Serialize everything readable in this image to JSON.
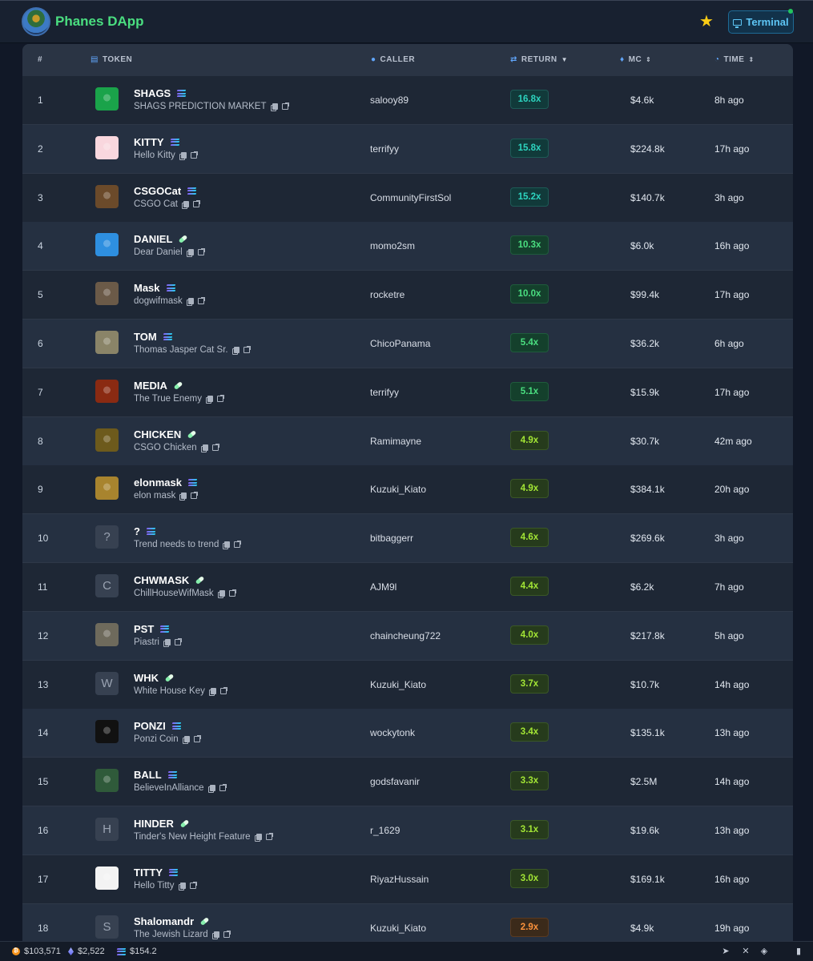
{
  "app": {
    "title": "Phanes DApp",
    "terminal_label": "Terminal"
  },
  "table": {
    "headers": {
      "rank": "#",
      "token": "TOKEN",
      "caller": "CALLER",
      "return": "RETURN",
      "mc": "MC",
      "time": "TIME"
    },
    "sort_column": "RETURN",
    "rows": [
      {
        "rank": "1",
        "symbol": "SHAGS",
        "name": "SHAGS PREDICTION MARKET",
        "chain": "solana",
        "caller": "salooy89",
        "return": "16.8x",
        "return_tier": "teal",
        "mc": "$4.6k",
        "time": "8h ago",
        "avatar": "image",
        "avatar_color": "#1aa34a"
      },
      {
        "rank": "2",
        "symbol": "KITTY",
        "name": "Hello Kitty",
        "chain": "solana",
        "caller": "terrifyy",
        "return": "15.8x",
        "return_tier": "teal",
        "mc": "$224.8k",
        "time": "17h ago",
        "avatar": "image",
        "avatar_color": "#f9d7de"
      },
      {
        "rank": "3",
        "symbol": "CSGOCat",
        "name": "CSGO Cat",
        "chain": "solana",
        "caller": "CommunityFirstSol",
        "return": "15.2x",
        "return_tier": "teal",
        "mc": "$140.7k",
        "time": "3h ago",
        "avatar": "image",
        "avatar_color": "#6b4a2a"
      },
      {
        "rank": "4",
        "symbol": "DANIEL",
        "name": "Dear Daniel",
        "chain": "pill",
        "caller": "momo2sm",
        "return": "10.3x",
        "return_tier": "green",
        "mc": "$6.0k",
        "time": "16h ago",
        "avatar": "image",
        "avatar_color": "#2e8fe0"
      },
      {
        "rank": "5",
        "symbol": "Mask",
        "name": "dogwifmask",
        "chain": "solana",
        "caller": "rocketre",
        "return": "10.0x",
        "return_tier": "green",
        "mc": "$99.4k",
        "time": "17h ago",
        "avatar": "image",
        "avatar_color": "#6b5a48"
      },
      {
        "rank": "6",
        "symbol": "TOM",
        "name": "Thomas Jasper Cat Sr.",
        "chain": "solana",
        "caller": "ChicoPanama",
        "return": "5.4x",
        "return_tier": "green",
        "mc": "$36.2k",
        "time": "6h ago",
        "avatar": "image",
        "avatar_color": "#8a8468"
      },
      {
        "rank": "7",
        "symbol": "MEDIA",
        "name": "The True Enemy",
        "chain": "pill",
        "caller": "terrifyy",
        "return": "5.1x",
        "return_tier": "green",
        "mc": "$15.9k",
        "time": "17h ago",
        "avatar": "image",
        "avatar_color": "#8a2a12"
      },
      {
        "rank": "8",
        "symbol": "CHICKEN",
        "name": "CSGO Chicken",
        "chain": "pill",
        "caller": "Ramimayne",
        "return": "4.9x",
        "return_tier": "lime",
        "mc": "$30.7k",
        "time": "42m ago",
        "avatar": "image",
        "avatar_color": "#6d5a1c"
      },
      {
        "rank": "9",
        "symbol": "elonmask",
        "name": "elon mask",
        "chain": "solana",
        "caller": "Kuzuki_Kiato",
        "return": "4.9x",
        "return_tier": "lime",
        "mc": "$384.1k",
        "time": "20h ago",
        "avatar": "image",
        "avatar_color": "#a8842e"
      },
      {
        "rank": "10",
        "symbol": "?",
        "name": "Trend needs to trend",
        "chain": "solana",
        "caller": "bitbaggerr",
        "return": "4.6x",
        "return_tier": "lime",
        "mc": "$269.6k",
        "time": "3h ago",
        "avatar": "?",
        "avatar_color": "#374151"
      },
      {
        "rank": "11",
        "symbol": "CHWMASK",
        "name": "ChillHouseWifMask",
        "chain": "pill",
        "caller": "AJM9l",
        "return": "4.4x",
        "return_tier": "lime",
        "mc": "$6.2k",
        "time": "7h ago",
        "avatar": "C",
        "avatar_color": "#374151"
      },
      {
        "rank": "12",
        "symbol": "PST",
        "name": "Piastri",
        "chain": "solana",
        "caller": "chaincheung722",
        "return": "4.0x",
        "return_tier": "lime",
        "mc": "$217.8k",
        "time": "5h ago",
        "avatar": "image",
        "avatar_color": "#6e6a5c"
      },
      {
        "rank": "13",
        "symbol": "WHK",
        "name": "White House Key",
        "chain": "pill",
        "caller": "Kuzuki_Kiato",
        "return": "3.7x",
        "return_tier": "lime",
        "mc": "$10.7k",
        "time": "14h ago",
        "avatar": "W",
        "avatar_color": "#374151"
      },
      {
        "rank": "14",
        "symbol": "PONZI",
        "name": "Ponzi Coin",
        "chain": "solana",
        "caller": "wockytonk",
        "return": "3.4x",
        "return_tier": "lime",
        "mc": "$135.1k",
        "time": "13h ago",
        "avatar": "image",
        "avatar_color": "#111111"
      },
      {
        "rank": "15",
        "symbol": "BALL",
        "name": "BelieveInAlliance",
        "chain": "solana",
        "caller": "godsfavanir",
        "return": "3.3x",
        "return_tier": "lime",
        "mc": "$2.5M",
        "time": "14h ago",
        "avatar": "image",
        "avatar_color": "#2f5a3a"
      },
      {
        "rank": "16",
        "symbol": "HINDER",
        "name": "Tinder's New Height Feature",
        "chain": "pill",
        "caller": "r_1629",
        "return": "3.1x",
        "return_tier": "lime",
        "mc": "$19.6k",
        "time": "13h ago",
        "avatar": "H",
        "avatar_color": "#374151"
      },
      {
        "rank": "17",
        "symbol": "TITTY",
        "name": "Hello Titty",
        "chain": "solana",
        "caller": "RiyazHussain",
        "return": "3.0x",
        "return_tier": "lime",
        "mc": "$169.1k",
        "time": "16h ago",
        "avatar": "image",
        "avatar_color": "#f3f3f3"
      },
      {
        "rank": "18",
        "symbol": "Shalomandr",
        "name": "The Jewish Lizard",
        "chain": "pill",
        "caller": "Kuzuki_Kiato",
        "return": "2.9x",
        "return_tier": "orange",
        "mc": "$4.9k",
        "time": "19h ago",
        "avatar": "S",
        "avatar_color": "#374151"
      }
    ]
  },
  "footer": {
    "btc_price": "$103,571",
    "eth_price": "$2,522",
    "sol_price": "$154.2"
  },
  "colors": {
    "accent_green": "#4ade80",
    "terminal_blue": "#5ec6f5",
    "star": "#facc15"
  }
}
